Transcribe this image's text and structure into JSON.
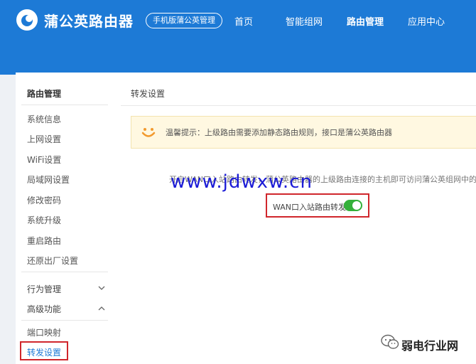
{
  "header": {
    "brand": "蒲公英路由器",
    "mobile_button": "手机版蒲公英管理",
    "nav": [
      {
        "label": "首页"
      },
      {
        "label": "智能组网"
      },
      {
        "label": "路由管理",
        "active": true
      },
      {
        "label": "应用中心"
      }
    ],
    "color": "#1d7ad6"
  },
  "sidebar": {
    "title": "路由管理",
    "items": [
      {
        "label": "系统信息"
      },
      {
        "label": "上网设置"
      },
      {
        "label": "WiFi设置"
      },
      {
        "label": "局域网设置"
      },
      {
        "label": "修改密码"
      },
      {
        "label": "系统升级"
      },
      {
        "label": "重启路由"
      },
      {
        "label": "还原出厂设置"
      }
    ],
    "groups": [
      {
        "label": "行为管理",
        "icon": "chevron-down-icon"
      },
      {
        "label": "高级功能",
        "icon": "chevron-up-icon"
      }
    ],
    "sub_items": [
      {
        "label": "端口映射"
      },
      {
        "label": "转发设置",
        "active": true
      }
    ]
  },
  "main": {
    "title": "转发设置",
    "tip": "温馨提示：上级路由需要添加静态路由规则，接口是蒲公英路由器",
    "description": "开启WAN口入站路由转发，蒲公英路由器的上级路由连接的主机即可访问蒲公英组网中的成员",
    "wan_toggle": {
      "label": "WAN口入站路由转发:",
      "on": true,
      "on_color": "#34b03a"
    }
  },
  "watermark": {
    "site": "www.jdwxw.cn",
    "account": "弱电行业网"
  }
}
